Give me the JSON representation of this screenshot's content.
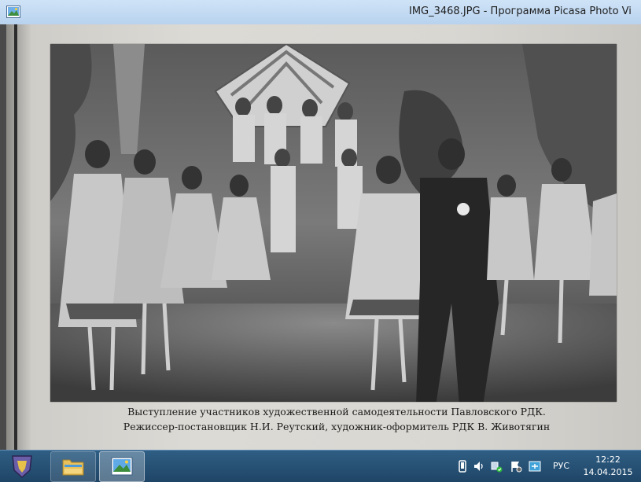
{
  "window": {
    "title": "IMG_3468.JPG - Программа Picasa Photo Vi"
  },
  "photo": {
    "caption_line1": "Выступление участников художественной самодеятельности Павловского РДК.",
    "caption_line2": "Режиссер-постановщик Н.И. Реутский, художник-оформитель РДК В. Животягин"
  },
  "taskbar": {
    "language": "РУС",
    "time": "12:22",
    "date": "14.04.2015",
    "items": [
      {
        "icon": "explorer-folder-icon"
      },
      {
        "icon": "picasa-photo-viewer-icon"
      }
    ]
  },
  "colors": {
    "titlebar": "#c4dbf3",
    "taskbar": "#28506f",
    "page": "#d9d7d2"
  }
}
